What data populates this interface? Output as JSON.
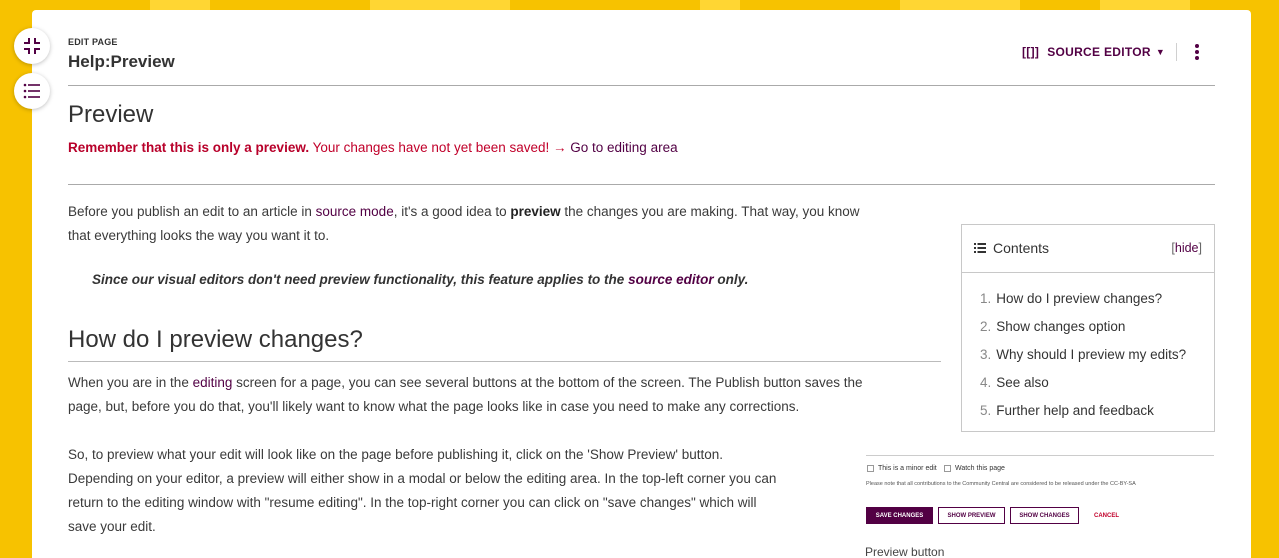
{
  "header": {
    "eyebrow": "EDIT PAGE",
    "title": "Help:Preview",
    "source_editor_icon": "[[]]",
    "source_editor_label": "SOURCE EDITOR"
  },
  "side_buttons": [
    {
      "icon": "collapse-icon"
    },
    {
      "icon": "table-of-contents-icon"
    }
  ],
  "page": {
    "heading": "Preview",
    "notice_bold": "Remember that this is only a preview.",
    "notice_text": " Your changes have not yet been saved! → ",
    "notice_link": "Go to editing area",
    "intro": {
      "t1": "Before you publish an edit to an article in ",
      "link1": "source mode",
      "t2": ", it's a good idea to ",
      "bold1": "preview",
      "t3": " the changes you are making. That way, you know",
      "t4": "that everything looks the way you want it to."
    },
    "note": {
      "t1": "Since our visual editors don't need preview functionality, this feature applies to the ",
      "link": "source editor",
      "t2": " only."
    },
    "section_heading": "How do I preview changes?",
    "p2": {
      "t1": "When you are in the ",
      "link": "editing",
      "t2": " screen for a page, you can see several buttons at the bottom of the screen. The Publish button saves the",
      "t3": "page, but, before you do that, you'll likely want to know what the page looks like in case you need to make any corrections."
    },
    "p3": {
      "l1": "So, to preview what your edit will look like on the page before publishing it, click on the 'Show Preview' button.",
      "l2": "Depending on your editor, a preview will either show in a modal or below the editing area. In the top-left corner you can",
      "l3": "return to the editing window with \"resume editing\". In the top-right corner you can click on \"save changes\" which will",
      "l4": "save your edit."
    }
  },
  "toc": {
    "title": "Contents",
    "hide_open": "[",
    "hide_label": "hide",
    "hide_close": "]",
    "items": [
      {
        "num": "1.",
        "label": "How do I preview changes?"
      },
      {
        "num": "2.",
        "label": "Show changes option"
      },
      {
        "num": "3.",
        "label": "Why should I preview my edits?"
      },
      {
        "num": "4.",
        "label": "See also"
      },
      {
        "num": "5.",
        "label": "Further help and feedback"
      }
    ]
  },
  "figure": {
    "minor_edit": "This is a minor edit",
    "watch_page": "Watch this page",
    "disclaimer": "Please note that all contributions to the Community Central are considered to be released under the CC-BY-SA",
    "save_changes": "SAVE CHANGES",
    "show_preview": "SHOW PREVIEW",
    "show_changes": "SHOW CHANGES",
    "cancel": "CANCEL",
    "caption": "Preview button"
  },
  "colors": {
    "background": "#f7c200",
    "accent": "#520044",
    "notice": "#c1002a"
  }
}
